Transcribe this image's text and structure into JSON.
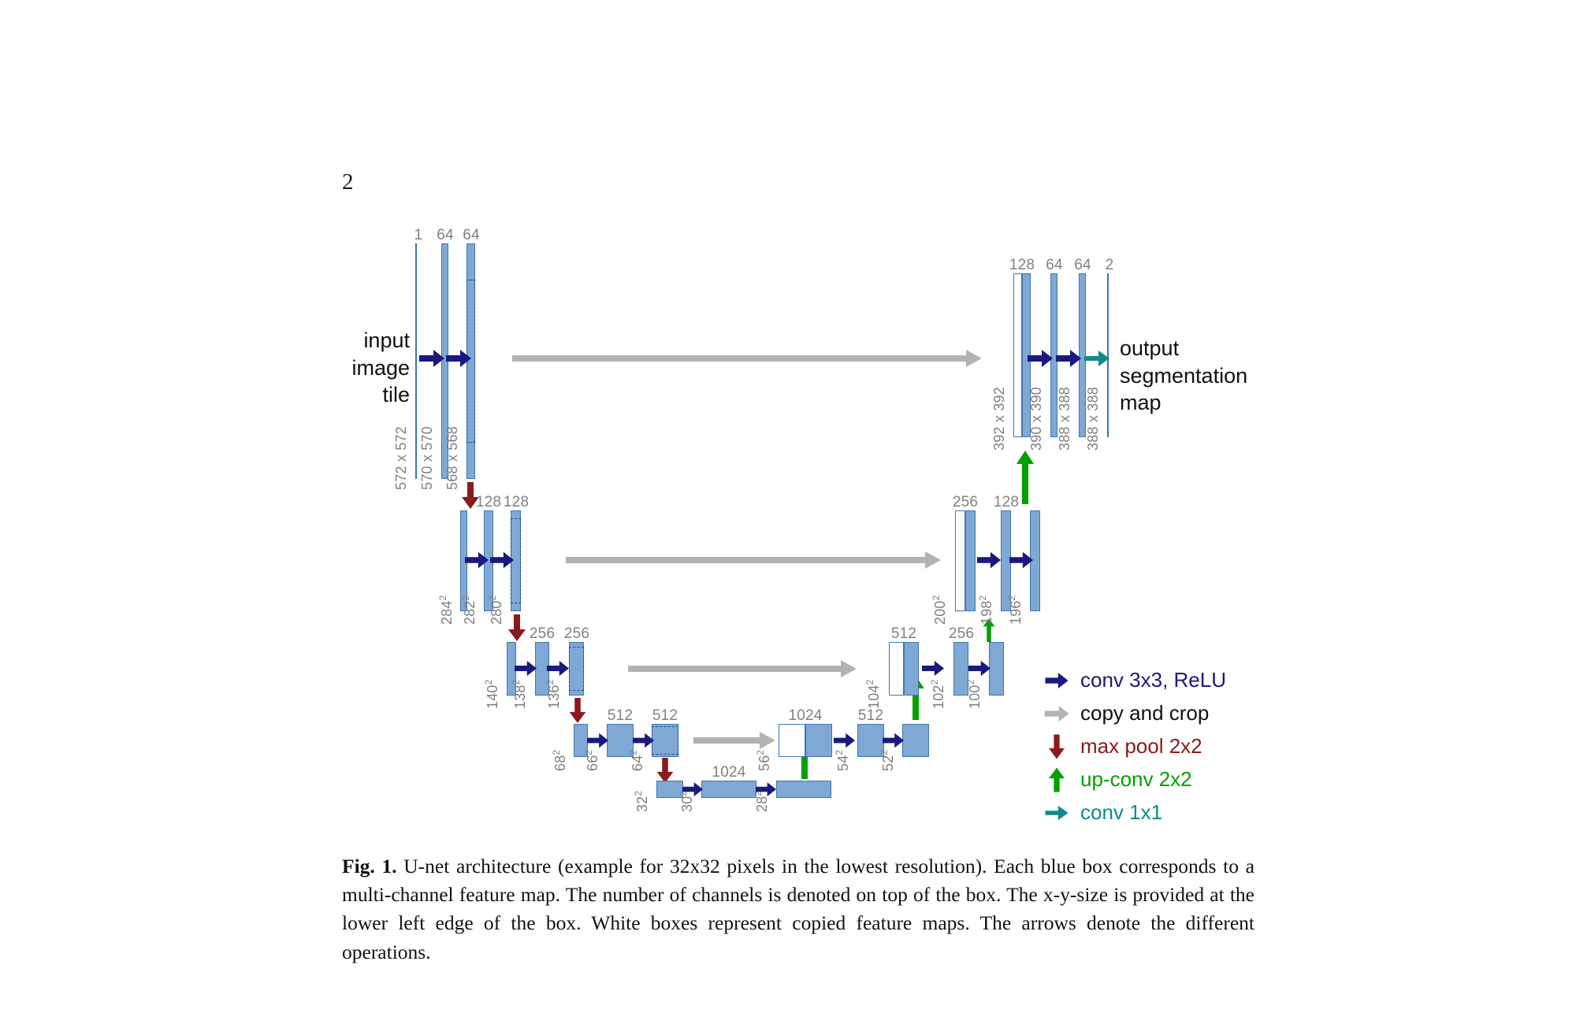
{
  "page": {
    "number": "2"
  },
  "figure": {
    "input_label": "input\nimage\ntile",
    "output_label": "output\nsegmentation\nmap",
    "colors": {
      "box_fill": "#7FA8D4",
      "box_stroke": "#4076B0",
      "conv_arrow": "#19197F",
      "copy_arrow": "#B3B3B3",
      "maxpool_arrow": "#8B1A1A",
      "upconv_arrow": "#00A000",
      "conv1x1_arrow": "#0F8B8B",
      "label_gray": "#808080"
    },
    "legend": [
      {
        "icon": "right-arrow-icon",
        "label": "conv 3x3, ReLU",
        "color": "#19197F"
      },
      {
        "icon": "right-arrow-icon",
        "label": "copy and crop",
        "color": "#B3B3B3",
        "text_color": "#111111"
      },
      {
        "icon": "down-arrow-icon",
        "label": "max pool 2x2",
        "color": "#8B1A1A"
      },
      {
        "icon": "up-arrow-icon",
        "label": "up-conv 2x2",
        "color": "#00A000"
      },
      {
        "icon": "right-arrow-icon",
        "label": "conv 1x1",
        "color": "#0F8B8B"
      }
    ]
  },
  "chart_data": {
    "type": "diagram",
    "title": "U-net architecture",
    "subtitle": "example for 32x32 pixels in the lowest resolution",
    "levels": [
      {
        "name": "level-1-encoder",
        "boxes": [
          {
            "id": "enc1-in",
            "channels": "1",
            "size": "572 x 572",
            "style": "thin"
          },
          {
            "id": "enc1-a",
            "channels": "64",
            "size": "570 x 570",
            "style": "solid"
          },
          {
            "id": "enc1-b",
            "channels": "64",
            "size": "568 x 568",
            "style": "dashed"
          }
        ]
      },
      {
        "name": "level-2-encoder",
        "boxes": [
          {
            "id": "enc2-in",
            "channels": "",
            "size": "284²",
            "style": "solid"
          },
          {
            "id": "enc2-a",
            "channels": "128",
            "size": "282²",
            "style": "solid"
          },
          {
            "id": "enc2-b",
            "channels": "128",
            "size": "280²",
            "style": "dashed"
          }
        ]
      },
      {
        "name": "level-3-encoder",
        "boxes": [
          {
            "id": "enc3-in",
            "channels": "",
            "size": "140²",
            "style": "solid"
          },
          {
            "id": "enc3-a",
            "channels": "256",
            "size": "138²",
            "style": "solid"
          },
          {
            "id": "enc3-b",
            "channels": "256",
            "size": "136²",
            "style": "dashed"
          }
        ]
      },
      {
        "name": "level-4-encoder",
        "boxes": [
          {
            "id": "enc4-in",
            "channels": "",
            "size": "68²",
            "style": "solid"
          },
          {
            "id": "enc4-a",
            "channels": "512",
            "size": "66²",
            "style": "solid"
          },
          {
            "id": "enc4-b",
            "channels": "512",
            "size": "64²",
            "style": "dashed"
          }
        ]
      },
      {
        "name": "level-5-bottleneck",
        "boxes": [
          {
            "id": "bot-in",
            "channels": "",
            "size": "32²",
            "style": "solid"
          },
          {
            "id": "bot-a",
            "channels": "1024",
            "size": "30²",
            "style": "solid"
          },
          {
            "id": "bot-b",
            "channels": "",
            "size": "28²",
            "style": "solid"
          }
        ]
      },
      {
        "name": "level-4-decoder",
        "boxes": [
          {
            "id": "dec4-cat",
            "channels": "1024",
            "size": "56²",
            "style": "half-white"
          },
          {
            "id": "dec4-a",
            "channels": "512",
            "size": "54²",
            "style": "solid"
          },
          {
            "id": "dec4-b",
            "channels": "",
            "size": "52²",
            "style": "solid"
          }
        ]
      },
      {
        "name": "level-3-decoder",
        "boxes": [
          {
            "id": "dec3-cat",
            "channels": "512",
            "size": "104²",
            "style": "half-white"
          },
          {
            "id": "dec3-a",
            "channels": "256",
            "size": "102²",
            "style": "solid"
          },
          {
            "id": "dec3-b",
            "channels": "",
            "size": "100²",
            "style": "solid"
          }
        ]
      },
      {
        "name": "level-2-decoder",
        "boxes": [
          {
            "id": "dec2-cat",
            "channels": "256",
            "size": "200²",
            "style": "half-white"
          },
          {
            "id": "dec2-a",
            "channels": "128",
            "size": "198²",
            "style": "solid"
          },
          {
            "id": "dec2-b",
            "channels": "",
            "size": "196²",
            "style": "solid"
          }
        ]
      },
      {
        "name": "level-1-decoder",
        "boxes": [
          {
            "id": "dec1-cat",
            "channels": "128",
            "size": "392 x 392",
            "style": "half-white"
          },
          {
            "id": "dec1-a",
            "channels": "64",
            "size": "390 x 390",
            "style": "solid"
          },
          {
            "id": "dec1-b",
            "channels": "64",
            "size": "388 x 388",
            "style": "solid"
          },
          {
            "id": "dec1-out",
            "channels": "2",
            "size": "388 x 388",
            "style": "thin"
          }
        ]
      }
    ],
    "operations": {
      "conv3x3": "conv 3x3, ReLU",
      "copy_crop": "copy and crop",
      "maxpool": "max pool 2x2",
      "upconv": "up-conv 2x2",
      "conv1x1": "conv 1x1"
    }
  },
  "caption": {
    "figure_number": "Fig. 1.",
    "text": " U-net architecture (example for 32x32 pixels in the lowest resolution). Each blue box corresponds to a multi-channel feature map. The number of channels is denoted on top of the box. The x-y-size is provided at the lower left edge of the box. White boxes represent copied feature maps. The arrows denote the different operations."
  }
}
